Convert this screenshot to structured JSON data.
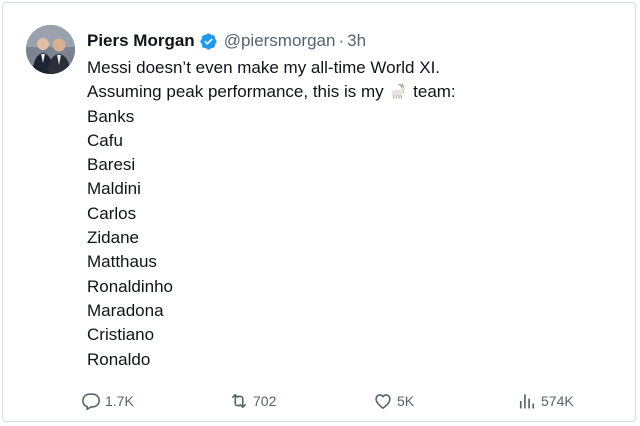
{
  "author": {
    "name": "Piers Morgan",
    "handle": "@piersmorgan",
    "separator": "·",
    "time": "3h",
    "verified_color": "#1d9bf0"
  },
  "tweet": {
    "line1": "Messi doesn’t even make my all-time World XI.",
    "line2_before": "Assuming peak performance, this is my",
    "line2_after": "team:",
    "emoji": "goat-icon",
    "players": [
      "Banks",
      "Cafu",
      "Baresi",
      "Maldini",
      "Carlos",
      "Zidane",
      "Matthaus",
      "Ronaldinho",
      "Maradona",
      "Cristiano",
      "Ronaldo"
    ]
  },
  "actions": {
    "replies": "1.7K",
    "retweets": "702",
    "likes": "5K",
    "views": "574K"
  }
}
